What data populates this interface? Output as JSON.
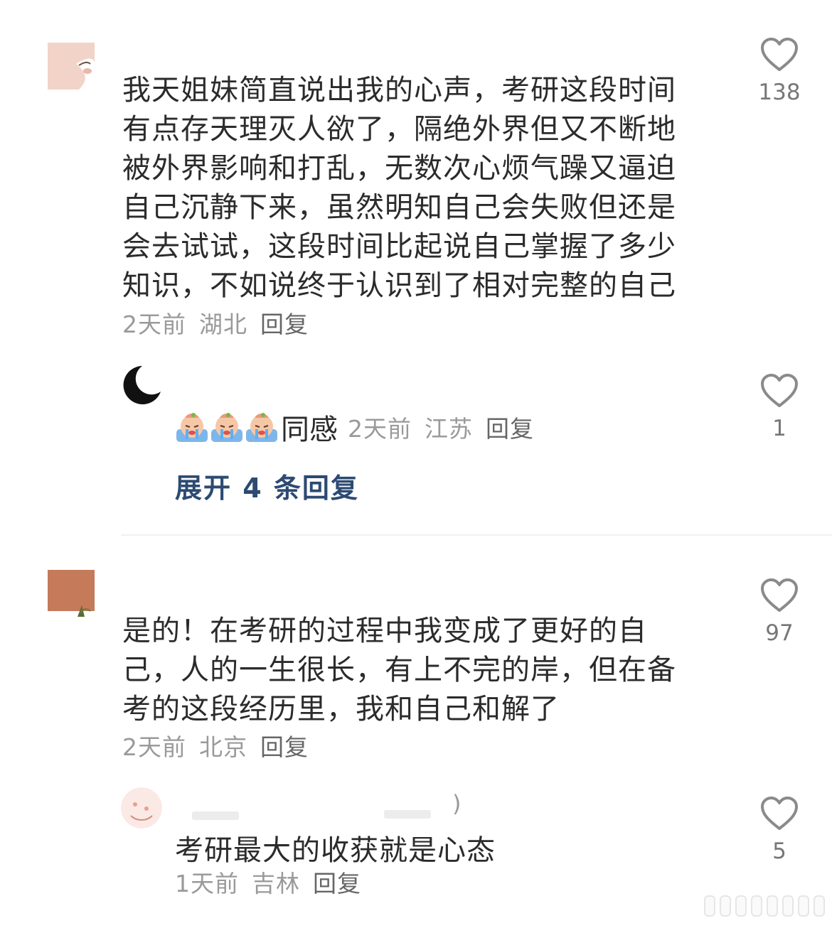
{
  "comments": [
    {
      "lines": [
        "我天姐妹简直说出我的心声，考研这段时间",
        "有点存天理灭人欲了，隔绝外界但又不断地",
        "被外界影响和打乱，无数次心烦气躁又逼迫",
        "自己沉静下来，虽然明知自己会失败但还是",
        "会去试试，这段时间比起说自己掌握了多少",
        "知识，不如说终于认识到了相对完整的自己"
      ],
      "time": "2天前",
      "location": "湖北",
      "reply_label": "回复",
      "likes": "138",
      "sub_reply": {
        "text": "同感",
        "time": "2天前",
        "location": "江苏",
        "reply_label": "回复",
        "likes": "1"
      },
      "expand_label": "展开 4 条回复"
    },
    {
      "lines": [
        "是的！在考研的过程中我变成了更好的自",
        "己，人的一生很长，有上不完的岸，但在备",
        "考的这段经历里，我和自己和解了"
      ],
      "time": "2天前",
      "location": "北京",
      "reply_label": "回复",
      "likes": "97",
      "sub_reply": {
        "name_suffix": ")",
        "text": "考研最大的收获就是心态",
        "time": "1天前",
        "location": "吉林",
        "reply_label": "回复",
        "likes": "5"
      }
    }
  ],
  "colors": {
    "text": "#2b2b2b",
    "meta": "#9a9a9a",
    "expand": "#2c4a72",
    "like_icon": "#8a8a8a"
  },
  "icons": [
    "heart-icon",
    "crying-emoji-icon"
  ]
}
